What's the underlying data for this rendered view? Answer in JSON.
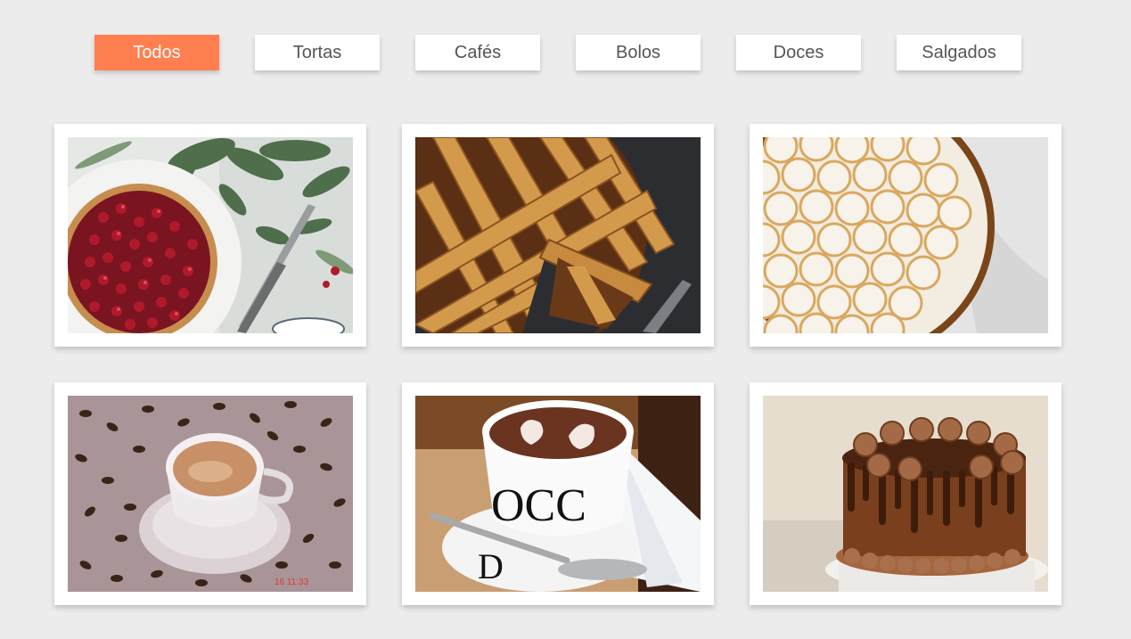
{
  "filters": [
    {
      "label": "Todos",
      "active": true
    },
    {
      "label": "Tortas",
      "active": false
    },
    {
      "label": "Cafés",
      "active": false
    },
    {
      "label": "Bolos",
      "active": false
    },
    {
      "label": "Doces",
      "active": false
    },
    {
      "label": "Salgados",
      "active": false
    }
  ],
  "gallery": [
    {
      "image": "cranberry-tart"
    },
    {
      "image": "lattice-pie"
    },
    {
      "image": "meringue-tart"
    },
    {
      "image": "coffee-cup-beans",
      "timestamp": "16 11:33"
    },
    {
      "image": "cocoa-latte-art"
    },
    {
      "image": "chocolate-drip-cake"
    }
  ],
  "colors": {
    "accent": "#ff7f50",
    "background": "#ececec",
    "card": "#ffffff",
    "tab_text": "#555555"
  }
}
